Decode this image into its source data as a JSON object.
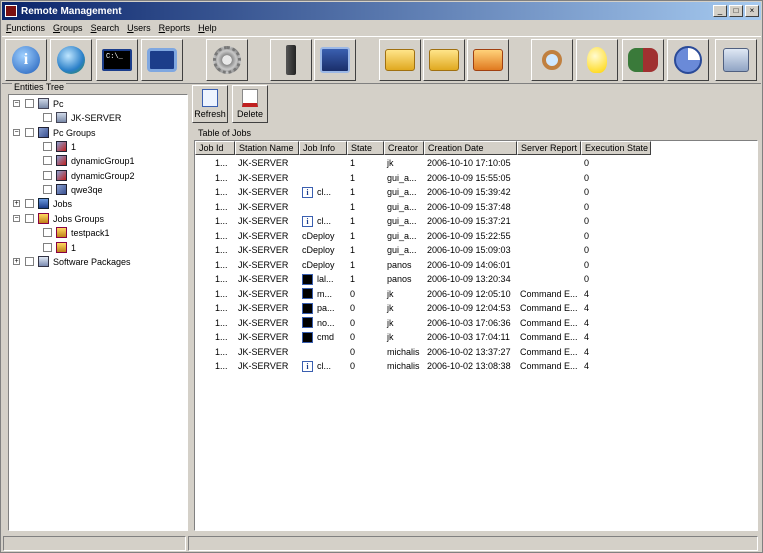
{
  "window": {
    "title": "Remote Management"
  },
  "window_controls": {
    "minimize": "_",
    "maximize": "□",
    "close": "×"
  },
  "menu": [
    "Functions",
    "Groups",
    "Search",
    "Users",
    "Reports",
    "Help"
  ],
  "toolbar_icons": [
    "info-icon",
    "globe-icon",
    "console-icon",
    "eye-icon",
    "gear-run-icon",
    "connector-icon",
    "remote-desktop-icon",
    "folder-open-icon",
    "folder-edit-icon",
    "folder-delete-icon",
    "search-icon",
    "lightbulb-icon",
    "users-icon",
    "pie-chart-icon",
    "network-icon"
  ],
  "entities_tree": {
    "label": "Entities Tree",
    "nodes": [
      {
        "label": "Pc",
        "expander": "−",
        "icon": "pc-icon"
      },
      {
        "label": "JK-SERVER",
        "icon": "pc-icon"
      },
      {
        "label": "Pc Groups",
        "expander": "−",
        "icon": "pc-group-icon"
      },
      {
        "label": "1",
        "icon": "pc-group-red-icon"
      },
      {
        "label": "dynamicGroup1",
        "icon": "pc-group-red-icon"
      },
      {
        "label": "dynamicGroup2",
        "icon": "pc-group-red-icon"
      },
      {
        "label": "qwe3qe",
        "icon": "pc-group-icon"
      },
      {
        "label": "Jobs",
        "expander": "+",
        "icon": "jobs-icon"
      },
      {
        "label": "Jobs Groups",
        "expander": "−",
        "icon": "job-group-icon"
      },
      {
        "label": "testpack1",
        "icon": "job-group-icon"
      },
      {
        "label": "1",
        "icon": "job-group-icon"
      },
      {
        "label": "Software Packages",
        "expander": "+",
        "icon": "software-icon"
      }
    ]
  },
  "actions": {
    "refresh": "Refresh",
    "delete": "Delete"
  },
  "jobs_table": {
    "label": "Table of Jobs",
    "columns": [
      "Job Id",
      "Station Name",
      "Job Info",
      "State",
      "Creator",
      "Creation Date",
      "Server Report",
      "Execution State"
    ],
    "rows": [
      {
        "job_id": "1...",
        "station": "JK-SERVER",
        "info_icon": "",
        "info": "",
        "state": "1",
        "creator": "jk",
        "date": "2006-10-10 17:10:05",
        "report": "",
        "exec": "0"
      },
      {
        "job_id": "1...",
        "station": "JK-SERVER",
        "info_icon": "",
        "info": "",
        "state": "1",
        "creator": "gui_a...",
        "date": "2006-10-09 15:55:05",
        "report": "",
        "exec": "0"
      },
      {
        "job_id": "1...",
        "station": "JK-SERVER",
        "info_icon": "info-icon",
        "info": "cl...",
        "state": "1",
        "creator": "gui_a...",
        "date": "2006-10-09 15:39:42",
        "report": "",
        "exec": "0"
      },
      {
        "job_id": "1...",
        "station": "JK-SERVER",
        "info_icon": "",
        "info": "",
        "state": "1",
        "creator": "gui_a...",
        "date": "2006-10-09 15:37:48",
        "report": "",
        "exec": "0"
      },
      {
        "job_id": "1...",
        "station": "JK-SERVER",
        "info_icon": "info-icon",
        "info": "cl...",
        "state": "1",
        "creator": "gui_a...",
        "date": "2006-10-09 15:37:21",
        "report": "",
        "exec": "0"
      },
      {
        "job_id": "1...",
        "station": "JK-SERVER",
        "info_icon": "",
        "info": "cDeploy",
        "state": "1",
        "creator": "gui_a...",
        "date": "2006-10-09 15:22:55",
        "report": "",
        "exec": "0"
      },
      {
        "job_id": "1...",
        "station": "JK-SERVER",
        "info_icon": "",
        "info": "cDeploy",
        "state": "1",
        "creator": "gui_a...",
        "date": "2006-10-09 15:09:03",
        "report": "",
        "exec": "0"
      },
      {
        "job_id": "1...",
        "station": "JK-SERVER",
        "info_icon": "",
        "info": "cDeploy",
        "state": "1",
        "creator": "panos",
        "date": "2006-10-09 14:06:01",
        "report": "",
        "exec": "0"
      },
      {
        "job_id": "1...",
        "station": "JK-SERVER",
        "info_icon": "console-icon",
        "info": "lal...",
        "state": "1",
        "creator": "panos",
        "date": "2006-10-09 13:20:34",
        "report": "",
        "exec": "0"
      },
      {
        "job_id": "1...",
        "station": "JK-SERVER",
        "info_icon": "console-icon",
        "info": "m...",
        "state": "0",
        "creator": "jk",
        "date": "2006-10-09 12:05:10",
        "report": "Command E...",
        "exec": "4"
      },
      {
        "job_id": "1...",
        "station": "JK-SERVER",
        "info_icon": "console-icon",
        "info": "pa...",
        "state": "0",
        "creator": "jk",
        "date": "2006-10-09 12:04:53",
        "report": "Command E...",
        "exec": "4"
      },
      {
        "job_id": "1...",
        "station": "JK-SERVER",
        "info_icon": "console-icon",
        "info": "no...",
        "state": "0",
        "creator": "jk",
        "date": "2006-10-03 17:06:36",
        "report": "Command E...",
        "exec": "4"
      },
      {
        "job_id": "1...",
        "station": "JK-SERVER",
        "info_icon": "console-icon",
        "info": "cmd",
        "state": "0",
        "creator": "jk",
        "date": "2006-10-03 17:04:11",
        "report": "Command E...",
        "exec": "4"
      },
      {
        "job_id": "1...",
        "station": "JK-SERVER",
        "info_icon": "",
        "info": "",
        "state": "0",
        "creator": "michalis",
        "date": "2006-10-02 13:37:27",
        "report": "Command E...",
        "exec": "4"
      },
      {
        "job_id": "1...",
        "station": "JK-SERVER",
        "info_icon": "info-icon",
        "info": "cl...",
        "state": "0",
        "creator": "michalis",
        "date": "2006-10-02 13:08:38",
        "report": "Command E...",
        "exec": "4"
      }
    ]
  }
}
